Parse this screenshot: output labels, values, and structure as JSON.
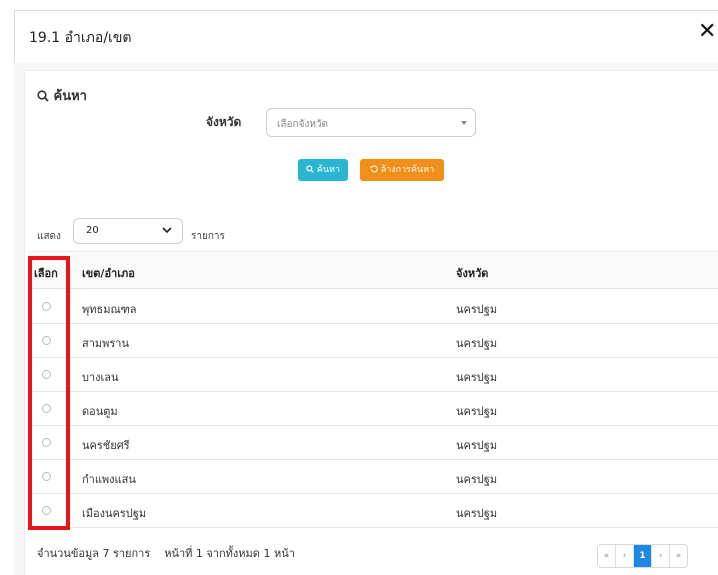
{
  "modal": {
    "title": "19.1 อำเภอ/เขต",
    "close": "✕"
  },
  "search": {
    "title": "ค้นหา",
    "province_label": "จังหวัด",
    "province_placeholder": "เลือกจังหวัด",
    "search_button": "ค้นหา",
    "clear_button": "ล้างการค้นหา"
  },
  "listing": {
    "show_label": "แสดง",
    "page_size": "20",
    "rows_label": "รายการ"
  },
  "table": {
    "headers": {
      "select": "เลือก",
      "district": "เขต/อำเภอ",
      "province": "จังหวัด"
    },
    "rows": [
      {
        "district": "พุทธมณฑล",
        "province": "นครปฐม"
      },
      {
        "district": "สามพราน",
        "province": "นครปฐม"
      },
      {
        "district": "บางเลน",
        "province": "นครปฐม"
      },
      {
        "district": "ดอนตูม",
        "province": "นครปฐม"
      },
      {
        "district": "นครชัยศรี",
        "province": "นครปฐม"
      },
      {
        "district": "กำแพงแสน",
        "province": "นครปฐม"
      },
      {
        "district": "เมืองนครปฐม",
        "province": "นครปฐม"
      }
    ]
  },
  "footer": {
    "summary": "จำนวนข้อมูล 7 รายการ    หน้าที่ 1 จากทั้งหมด 1 หน้า",
    "pager": {
      "first": "«",
      "prev": "‹",
      "current": "1",
      "next": "›",
      "last": "»"
    }
  },
  "colors": {
    "search_btn": "#29b6d3",
    "clear_btn": "#f09018",
    "highlight": "#e8151b",
    "active_page": "#1e88e5"
  }
}
